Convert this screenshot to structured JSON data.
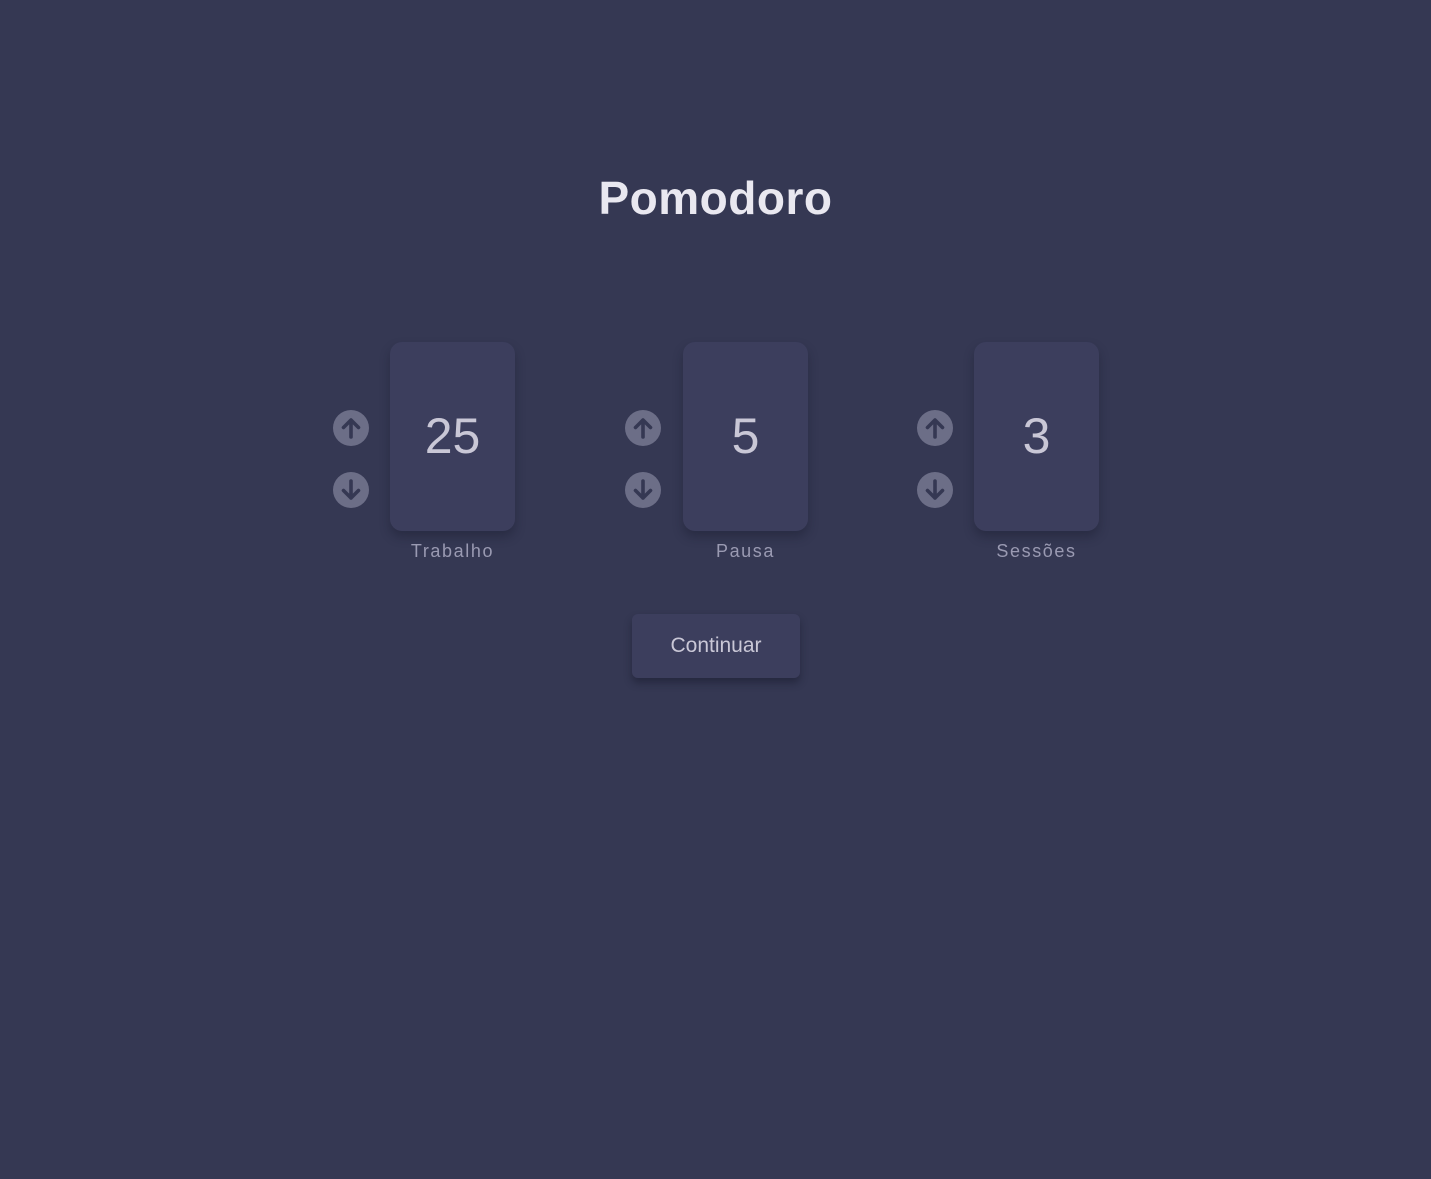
{
  "app": {
    "title": "Pomodoro"
  },
  "controls": [
    {
      "label": "Trabalho",
      "value": "25"
    },
    {
      "label": "Pausa",
      "value": "5"
    },
    {
      "label": "Sessões",
      "value": "3"
    }
  ],
  "actions": {
    "continue_label": "Continuar"
  },
  "icons": {
    "increment": "arrow-up-circle-icon",
    "decrement": "arrow-down-circle-icon"
  },
  "colors": {
    "background": "#353853",
    "card": "#3c3e5d",
    "title": "#e9e8f0",
    "value_text": "#c9c7d6",
    "label_text": "#9a9ab2",
    "arrow": "#6c6e87"
  }
}
